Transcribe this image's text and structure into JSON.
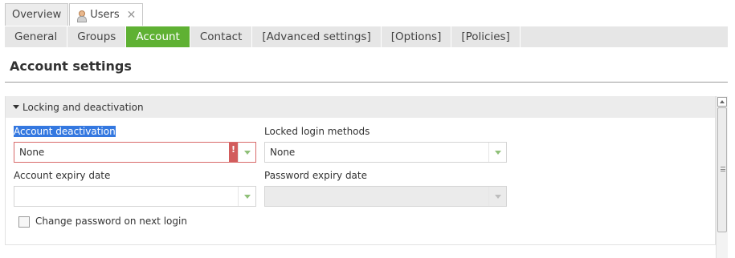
{
  "top_tabs": [
    {
      "label": "Overview"
    },
    {
      "label": "Users",
      "icon": "user-icon",
      "close_icon": "close-icon",
      "close_glyph": "✕"
    }
  ],
  "sub_tabs": [
    "General",
    "Groups",
    "Account",
    "Contact",
    "[Advanced settings]",
    "[Options]",
    "[Policies]"
  ],
  "active_sub_tab": "Account",
  "page_title": "Account settings",
  "panel": {
    "title": "Locking and deactivation",
    "account_deactivation": {
      "label": "Account deactivation",
      "value": "None",
      "error_mark": "!"
    },
    "locked_login_methods": {
      "label": "Locked login methods",
      "value": "None"
    },
    "account_expiry_date": {
      "label": "Account expiry date",
      "value": ""
    },
    "password_expiry_date": {
      "label": "Password expiry date",
      "value": ""
    },
    "change_password_checkbox": {
      "label": "Change password on next login",
      "checked": false
    }
  },
  "colors": {
    "active_tab": "#5fb133",
    "selection": "#3478e0",
    "error": "#d25c5c"
  }
}
